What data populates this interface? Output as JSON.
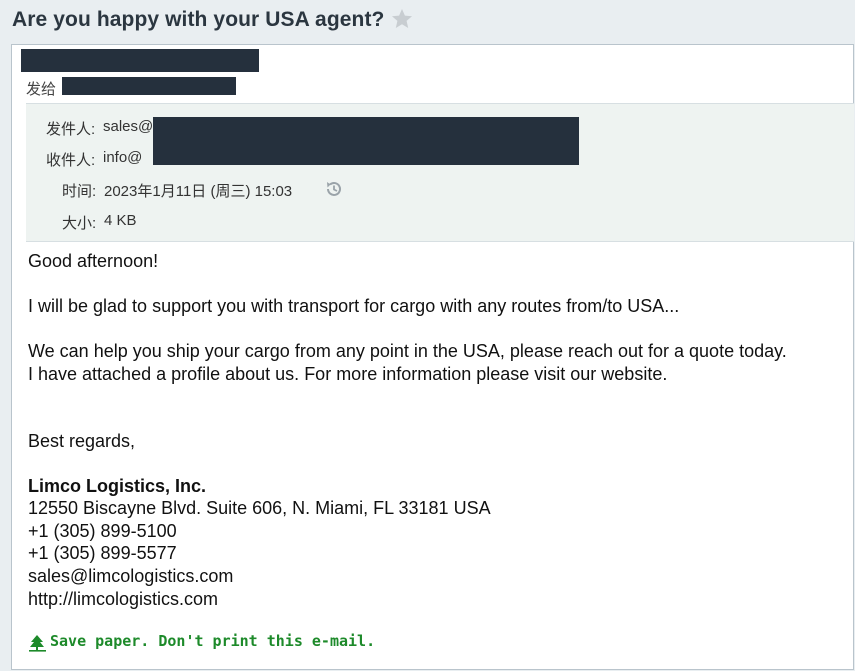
{
  "email": {
    "subject": "Are you happy with your USA agent?",
    "to_prefix": "发给",
    "header": {
      "from_label": "发件人:",
      "from_value": "sales@",
      "to_label": "收件人:",
      "to_value": "info@",
      "time_label": "时间:",
      "time_value": "2023年1月11日 (周三) 15:03",
      "size_label": "大小:",
      "size_value": "4 KB"
    },
    "body": {
      "greeting": "Good afternoon!",
      "line1": "I will be glad to support you with transport for cargo with any routes from/to USA...",
      "line2": "We can help you ship your cargo from any point in the USA, please reach out for a quote today.",
      "line3": "I have attached a profile about us. For more information please visit our website.",
      "closing": "Best regards,",
      "company": "Limco Logistics, Inc.",
      "address": "12550 Biscayne Blvd. Suite 606, N. Miami, FL 33181 USA",
      "phone1": "+1 (305) 899-5100",
      "phone2": "+1 (305) 899-5577",
      "email": "sales@limcologistics.com",
      "website": "http://limcologistics.com"
    },
    "footer_note": "Save paper. Don't print this e-mail."
  },
  "colors": {
    "redaction": "#25303d",
    "eco_green": "#1d8a2a",
    "header_bg": "#eef3f1"
  },
  "icons": [
    "star-icon",
    "history-icon",
    "tree-icon"
  ]
}
